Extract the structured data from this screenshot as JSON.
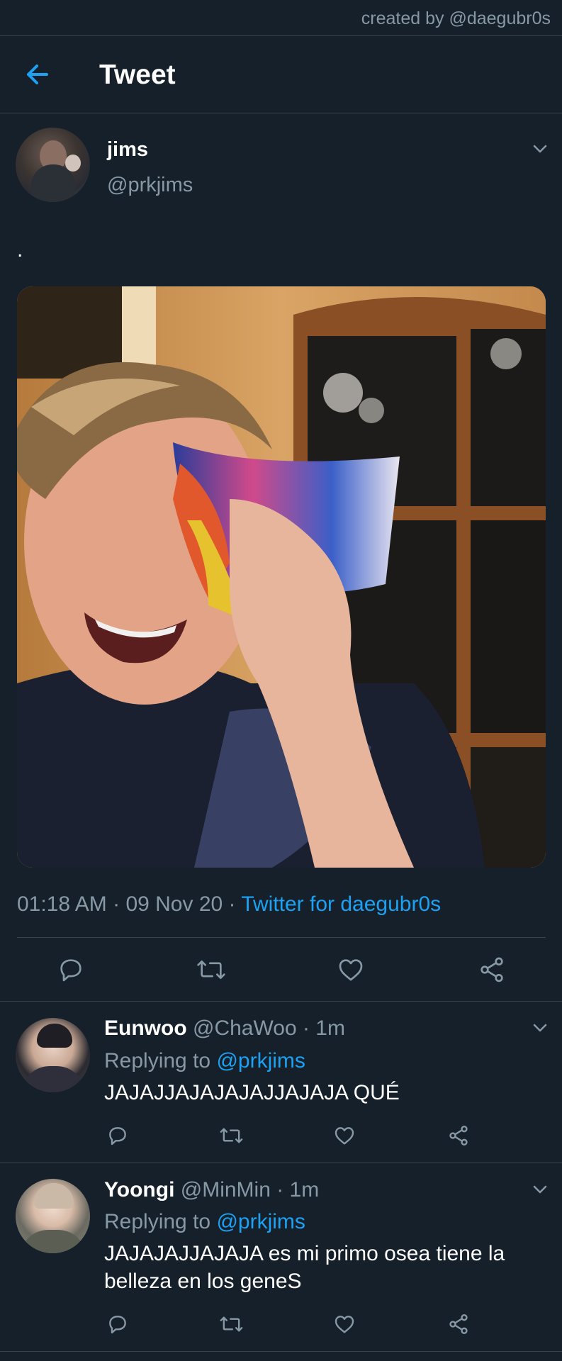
{
  "credit": "created by @daegubr0s",
  "header": {
    "title": "Tweet",
    "back_icon": "arrow-left-icon"
  },
  "tweet": {
    "author_name": "jims",
    "author_handle": "@prkjims",
    "text": ".",
    "time": "01:18 AM",
    "date": "09 Nov 20",
    "source": "Twitter for daegubr0s",
    "separator": " · "
  },
  "actions": [
    "reply-icon",
    "retweet-icon",
    "like-icon",
    "share-icon"
  ],
  "replies": [
    {
      "name": "Eunwoo",
      "handle_time": "@ChaWoo · 1m",
      "replying_label": "Replying to ",
      "replying_handle": "@prkjims",
      "text": "JAJAJJAJAJAJAJJAJAJA QUÉ"
    },
    {
      "name": "Yoongi",
      "handle_time": "@MinMin · 1m",
      "replying_label": "Replying to ",
      "replying_handle": "@prkjims",
      "text": "JAJAJAJJAJAJA es mi primo osea tiene la belleza en los geneS"
    }
  ],
  "colors": {
    "background": "#15202b",
    "accent": "#1da1f2",
    "secondary_text": "#8899a6",
    "divider": "#38444d"
  }
}
